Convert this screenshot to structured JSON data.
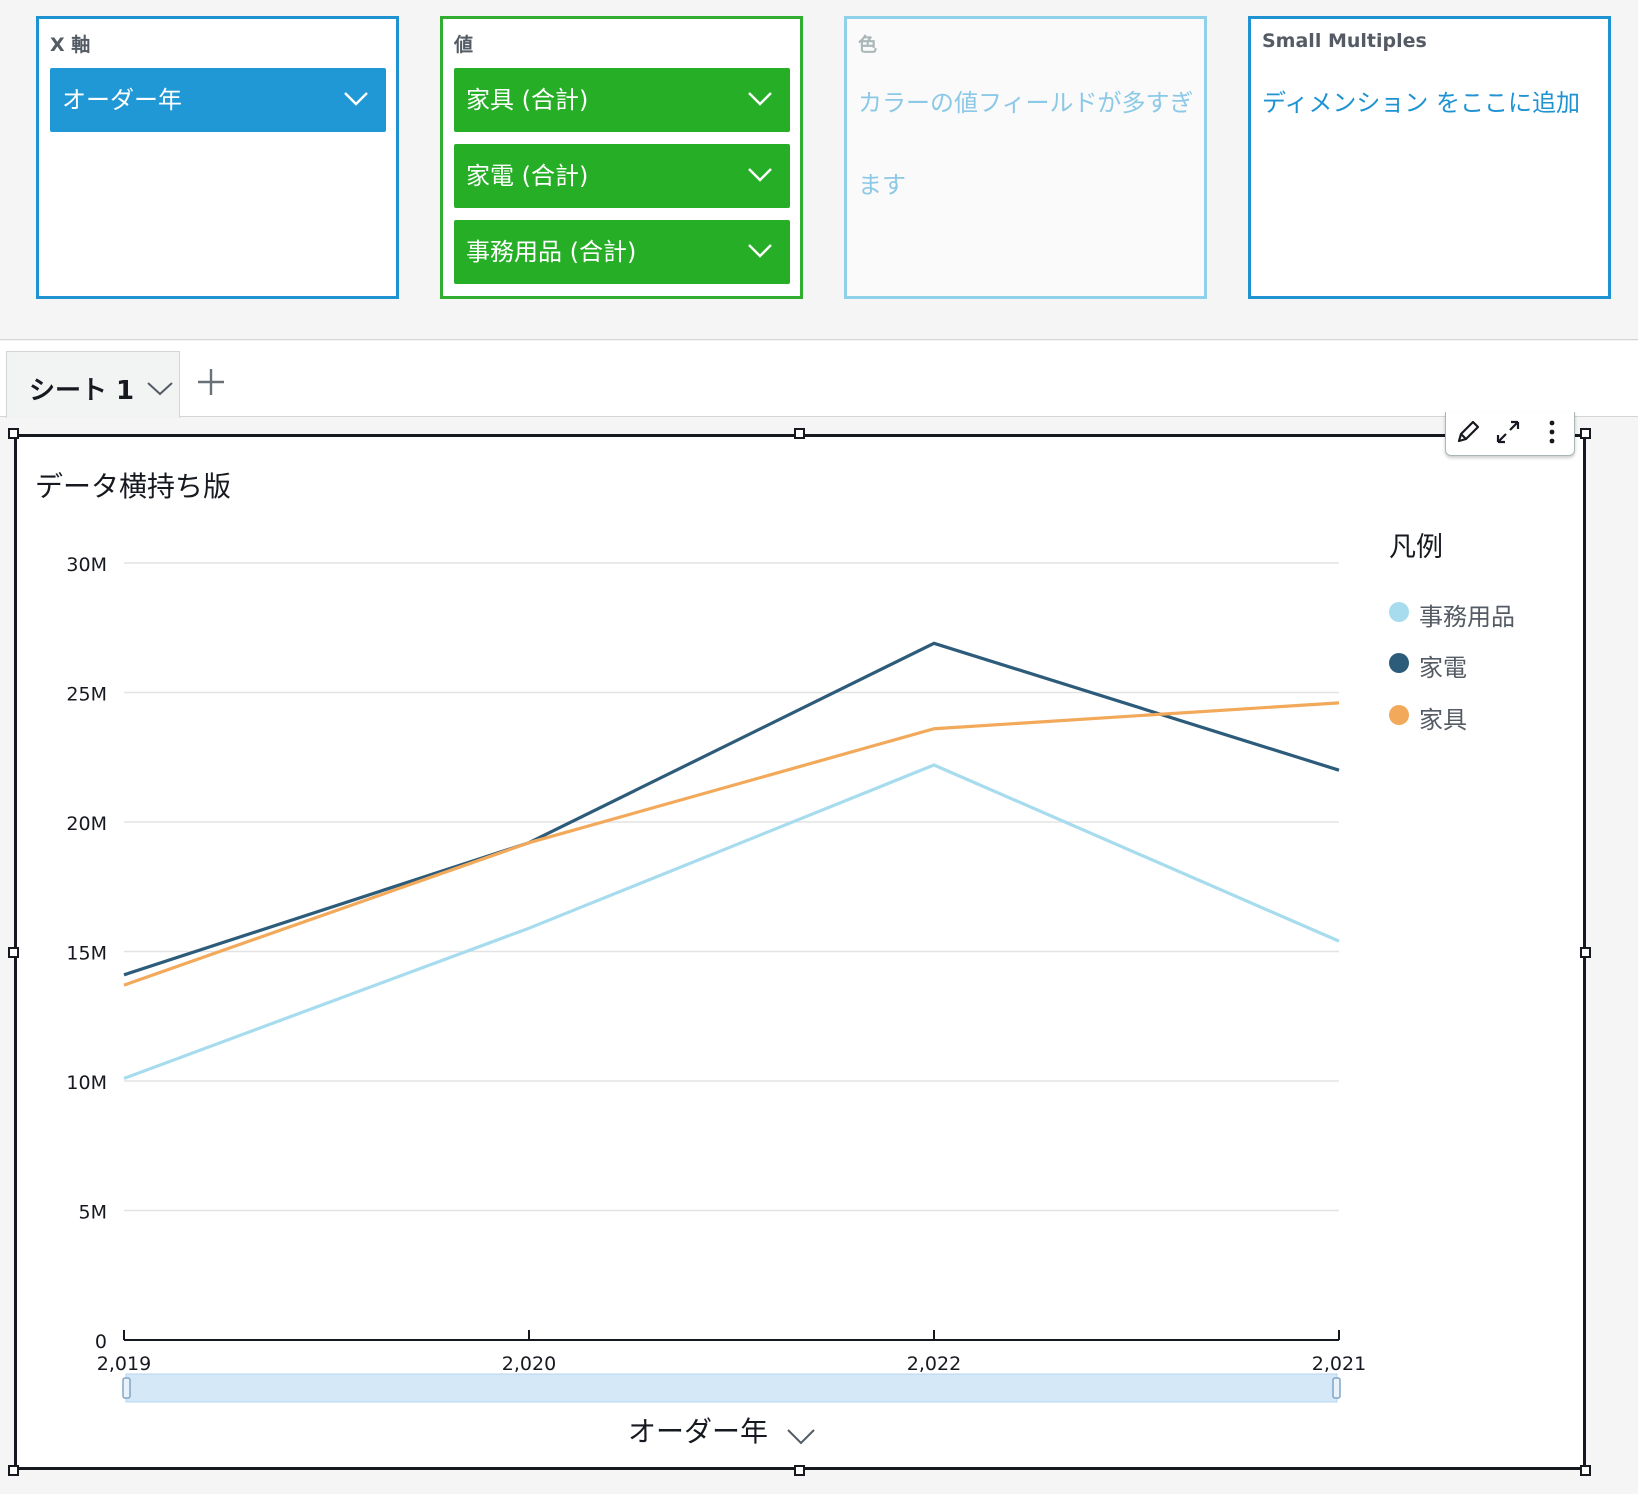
{
  "field_wells": {
    "xaxis": {
      "title": "X 軸",
      "fields": [
        {
          "label": "オーダー年"
        }
      ]
    },
    "value": {
      "title": "値",
      "fields": [
        {
          "label": "家具 (合計)"
        },
        {
          "label": "家電 (合計)"
        },
        {
          "label": "事務用品 (合計)"
        }
      ]
    },
    "color": {
      "title": "色",
      "message_line1": "カラーの値フィールドが多すぎ",
      "message_line2": "ます"
    },
    "small_multiples": {
      "title": "Small Multiples",
      "placeholder": "ディメンション をここに追加"
    }
  },
  "tabs": [
    {
      "label": "シート 1"
    }
  ],
  "colors": {
    "xaxis_chip": "#2198d6",
    "value_chip": "#27ae27",
    "value_border": "#31ad31",
    "disabled_border": "#8fd0ea",
    "disabled_text": "#8cc9e6",
    "link_text": "#1f93d2",
    "grid": "#e3e3e3"
  },
  "visual": {
    "title": "データ横持ち版",
    "legend_title": "凡例"
  },
  "chart_data": {
    "type": "line",
    "title": "データ横持ち版",
    "xlabel": "オーダー年",
    "ylabel": "",
    "categories": [
      "2,019",
      "2,020",
      "2,022",
      "2,021"
    ],
    "ylim": [
      0,
      30000000
    ],
    "yticks": [
      {
        "value": 0,
        "label": "0"
      },
      {
        "value": 5000000,
        "label": "5M"
      },
      {
        "value": 10000000,
        "label": "10M"
      },
      {
        "value": 15000000,
        "label": "15M"
      },
      {
        "value": 20000000,
        "label": "20M"
      },
      {
        "value": 25000000,
        "label": "25M"
      },
      {
        "value": 30000000,
        "label": "30M"
      }
    ],
    "grid": true,
    "legend_position": "right",
    "series": [
      {
        "name": "事務用品",
        "color": "#a7dcee",
        "values": [
          10100000,
          15900000,
          22200000,
          15400000
        ]
      },
      {
        "name": "家電",
        "color": "#2d5b7a",
        "values": [
          14100000,
          19200000,
          26900000,
          22000000
        ]
      },
      {
        "name": "家具",
        "color": "#f2a95a",
        "values": [
          13700000,
          19200000,
          23600000,
          24600000
        ]
      }
    ]
  }
}
